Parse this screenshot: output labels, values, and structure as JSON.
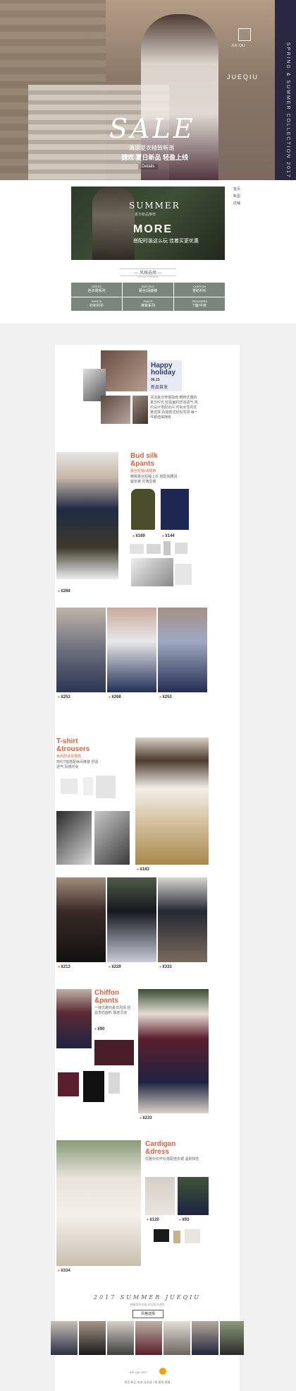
{
  "hero": {
    "sale": "SALE",
    "line1": "清凉夏衣精致新潮",
    "line2": "捷欢 夏日新品 轻盈上线",
    "details": "Details",
    "brand": "JUEQIU",
    "side_text": "SPRING & SUMMER COLLECTION 2017",
    "logo_caption": "JUE QIU"
  },
  "summer_banner": {
    "title": "SUMMER",
    "subtitle": "夏日新品推荐",
    "more": "MORE",
    "tagline": "搭配时装这么玩 佳着买更优惠"
  },
  "side_nav": [
    "首页",
    "新品",
    "店铺"
  ],
  "categories": {
    "title": "— 风格选择 —",
    "subtitle": "STYLE CHOICE",
    "items": [
      {
        "en": "DRESS",
        "zh": "连衣裙系列"
      },
      {
        "en": "BUD SILK",
        "zh": "蕾丝/阔腿裤"
      },
      {
        "en": "CHIFFON",
        "zh": "雪纺衬衫"
      },
      {
        "en": "SHIRTS",
        "zh": "针织衬衫"
      },
      {
        "en": "PANTS",
        "zh": "裤装系列"
      },
      {
        "en": "TROUSERS",
        "zh": "T恤/半身"
      }
    ]
  },
  "holiday": {
    "title_line1": "Happy",
    "title_line2": "holiday",
    "date": "06.15",
    "tag": "新品首发",
    "desc": "清凉夏日穿搭指南 精致优雅的夏日时光 轻盈面料舒适透气 简约设计搭配出众 时尚女性的优雅选择 百搭款式轻松驾驭 每一件都值得拥有"
  },
  "bud_silk": {
    "title1": "Bud silk",
    "title2": "&pants",
    "subtitle": "蕾丝短袖/阔腿裤",
    "desc": "精致蕾丝短袖上衣 搭配高腰阔腿长裤 优雅显瘦",
    "price_main": "¥268",
    "price_a": "¥169",
    "price_b": "¥144",
    "row_prices": [
      "¥253",
      "¥268",
      "¥253"
    ]
  },
  "tshirt": {
    "title1": "T-shirt",
    "title2": "&trousers",
    "subtitle": "休闲舒适百搭款",
    "desc": "简约T恤搭配休闲裤装 舒适透气 百搭时尚",
    "price_main": "¥183",
    "row_prices": [
      "¥213",
      "¥229",
      "¥333"
    ]
  },
  "chiffon": {
    "title1": "Chiffon",
    "title2": "&pants",
    "desc": "一抹优雅的夏日风情 轻盈雪纺面料 飘逸灵动",
    "price_a": "¥90",
    "price_main": "¥233"
  },
  "cardigan": {
    "title1": "Cardigan",
    "title2": "&dress",
    "desc": "优雅针织开衫搭配连衣裙 温柔知性",
    "price_main": "¥334",
    "price_a": "¥120",
    "price_b": "¥93"
  },
  "footer": {
    "heading": "2017 SUMMER JUEQIU",
    "desc": "感谢您的光临 欢迎再次选购",
    "button": "风格选择",
    "bottom_caption": "JUE QIU 2017",
    "links": "首页 新品 热卖 连衣裙 T恤 裤装 收藏"
  },
  "colors": {
    "accent": "#e0613c",
    "sale_text": "#ffffff",
    "category_bg": "#7b857c",
    "holiday_blue": "#2f3b6c"
  }
}
